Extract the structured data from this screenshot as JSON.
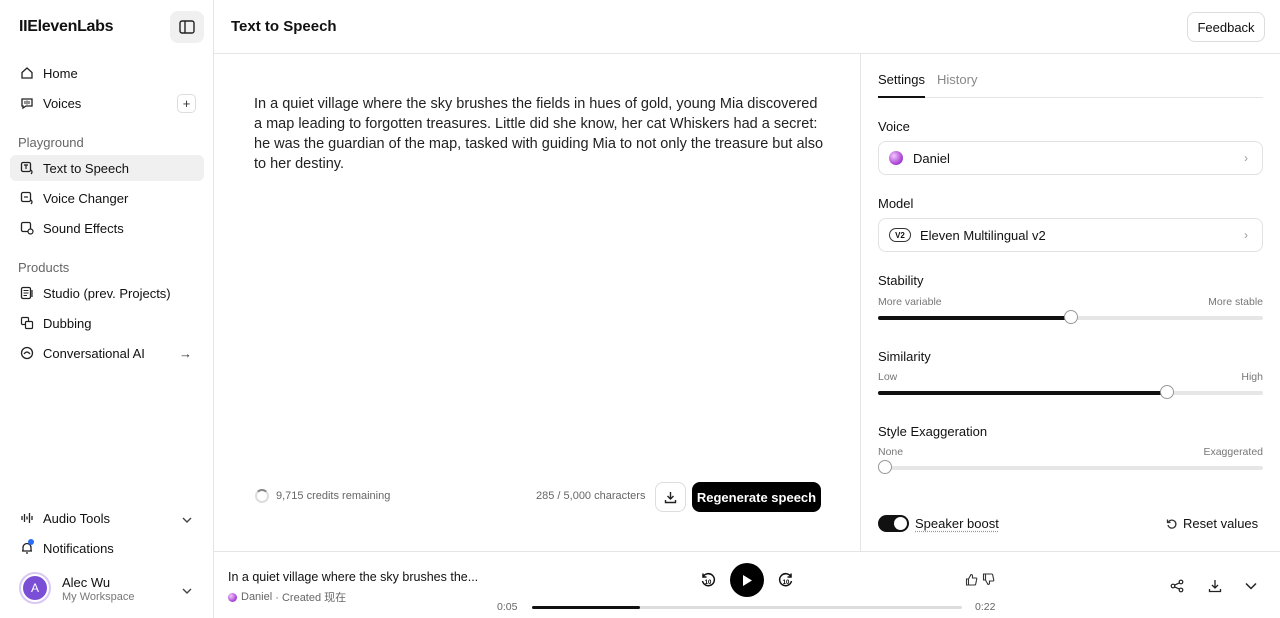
{
  "sidebar": {
    "logo": "IIElevenLabs",
    "items": [
      {
        "label": "Home",
        "icon": "home-icon"
      },
      {
        "label": "Voices",
        "icon": "voices-icon"
      }
    ],
    "playground_section": "Playground",
    "playground": [
      {
        "label": "Text to Speech",
        "icon": "text-to-speech-icon",
        "active": true
      },
      {
        "label": "Voice Changer",
        "icon": "voice-changer-icon"
      },
      {
        "label": "Sound Effects",
        "icon": "sound-effects-icon"
      }
    ],
    "products_section": "Products",
    "products": [
      {
        "label": "Studio (prev. Projects)",
        "icon": "studio-icon"
      },
      {
        "label": "Dubbing",
        "icon": "dubbing-icon"
      },
      {
        "label": "Conversational AI",
        "icon": "conversational-ai-icon"
      }
    ],
    "audio_tools": "Audio Tools",
    "notifications": "Notifications",
    "user": {
      "initial": "A",
      "name": "Alec Wu",
      "workspace": "My Workspace"
    }
  },
  "header": {
    "title": "Text to Speech",
    "feedback": "Feedback"
  },
  "editor": {
    "text": "In a quiet village where the sky brushes the fields in hues of gold, young Mia discovered a map leading to forgotten treasures. Little did she know, her cat Whiskers had a secret: he was the guardian of the map, tasked with guiding Mia to not only the treasure but also to her destiny.",
    "credits": "9,715 credits remaining",
    "char_count": "285 / 5,000 characters",
    "regenerate": "Regenerate speech"
  },
  "settings": {
    "tab_settings": "Settings",
    "tab_history": "History",
    "voice_label": "Voice",
    "voice_value": "Daniel",
    "model_label": "Model",
    "model_badge": "V2",
    "model_value": "Eleven Multilingual v2",
    "stability": {
      "label": "Stability",
      "min": "More variable",
      "max": "More stable",
      "value": 0.5
    },
    "similarity": {
      "label": "Similarity",
      "min": "Low",
      "max": "High",
      "value": 0.75
    },
    "style": {
      "label": "Style Exaggeration",
      "min": "None",
      "max": "Exaggerated",
      "value": 0.0
    },
    "speaker_boost": "Speaker boost",
    "speaker_boost_on": true,
    "reset": "Reset values"
  },
  "player": {
    "title": "In a quiet village where the sky brushes the...",
    "voice": "Daniel",
    "created": "· Created 现在",
    "current": "0:05",
    "duration": "0:22",
    "progress": 0.25,
    "skip_back": "10",
    "skip_fwd": "10"
  },
  "colors": {
    "accent": "#000000",
    "active_bg": "#f0f0f0",
    "voice_orb": "#b04cd6"
  }
}
